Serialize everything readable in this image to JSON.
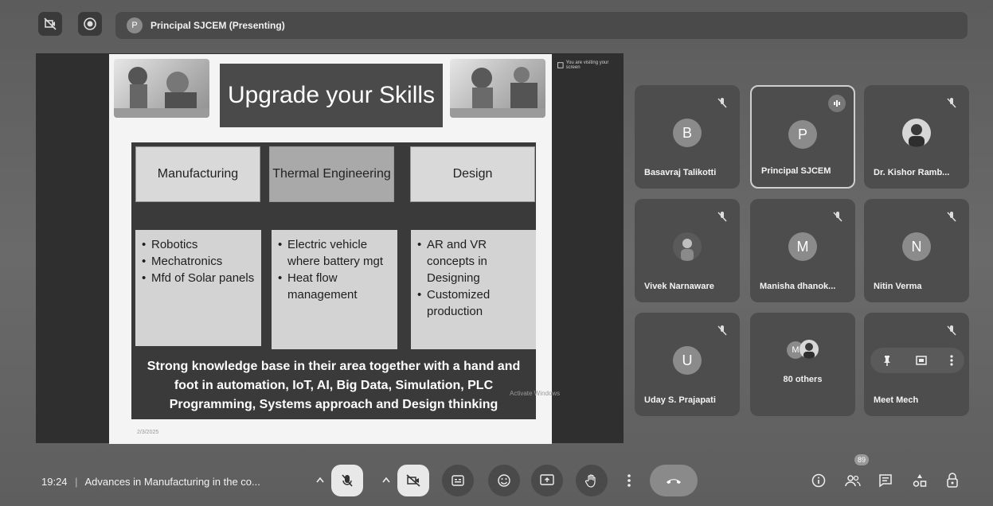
{
  "top_bar": {
    "presenter_initial": "P",
    "presenting_label": "Principal SJCEM (Presenting)"
  },
  "slide": {
    "title": "Upgrade your Skills",
    "categories": [
      "Manufacturing",
      "Thermal Engineering",
      "Design"
    ],
    "manufacturing_items": [
      "Robotics",
      "Mechatronics",
      "Mfd of Solar panels"
    ],
    "thermal_items": [
      "Electric vehicle where battery mgt",
      "Heat flow management"
    ],
    "design_items": [
      "AR and VR concepts in Designing",
      "Customized production"
    ],
    "banner": "Strong knowledge base in their area together with a hand and foot in automation, IoT, AI, Big Data, Simulation, PLC Programming, Systems approach and Design thinking",
    "date": "2/3/2025",
    "toast": "You are visiting your screen",
    "watermark": "Activate Windows"
  },
  "participants": [
    {
      "initial": "B",
      "name": "Basavraj Talikotti",
      "muted": true
    },
    {
      "initial": "P",
      "name": "Principal SJCEM",
      "speaking": true
    },
    {
      "initial": "",
      "name": "Dr. Kishor Ramb...",
      "muted": true,
      "photo": true
    },
    {
      "initial": "",
      "name": "Vivek Narnaware",
      "muted": true,
      "photo": true
    },
    {
      "initial": "M",
      "name": "Manisha dhanok...",
      "muted": true
    },
    {
      "initial": "N",
      "name": "Nitin Verma",
      "muted": true
    },
    {
      "initial": "U",
      "name": "Uday S. Prajapati",
      "muted": true
    },
    {
      "initial": "M",
      "name": "80 others"
    },
    {
      "initial": "",
      "name": "Meet Mech",
      "muted": true
    }
  ],
  "bottom_bar": {
    "time": "19:24",
    "separator": "|",
    "meeting_title": "Advances in Manufacturing in the co...",
    "people_count": "89"
  }
}
